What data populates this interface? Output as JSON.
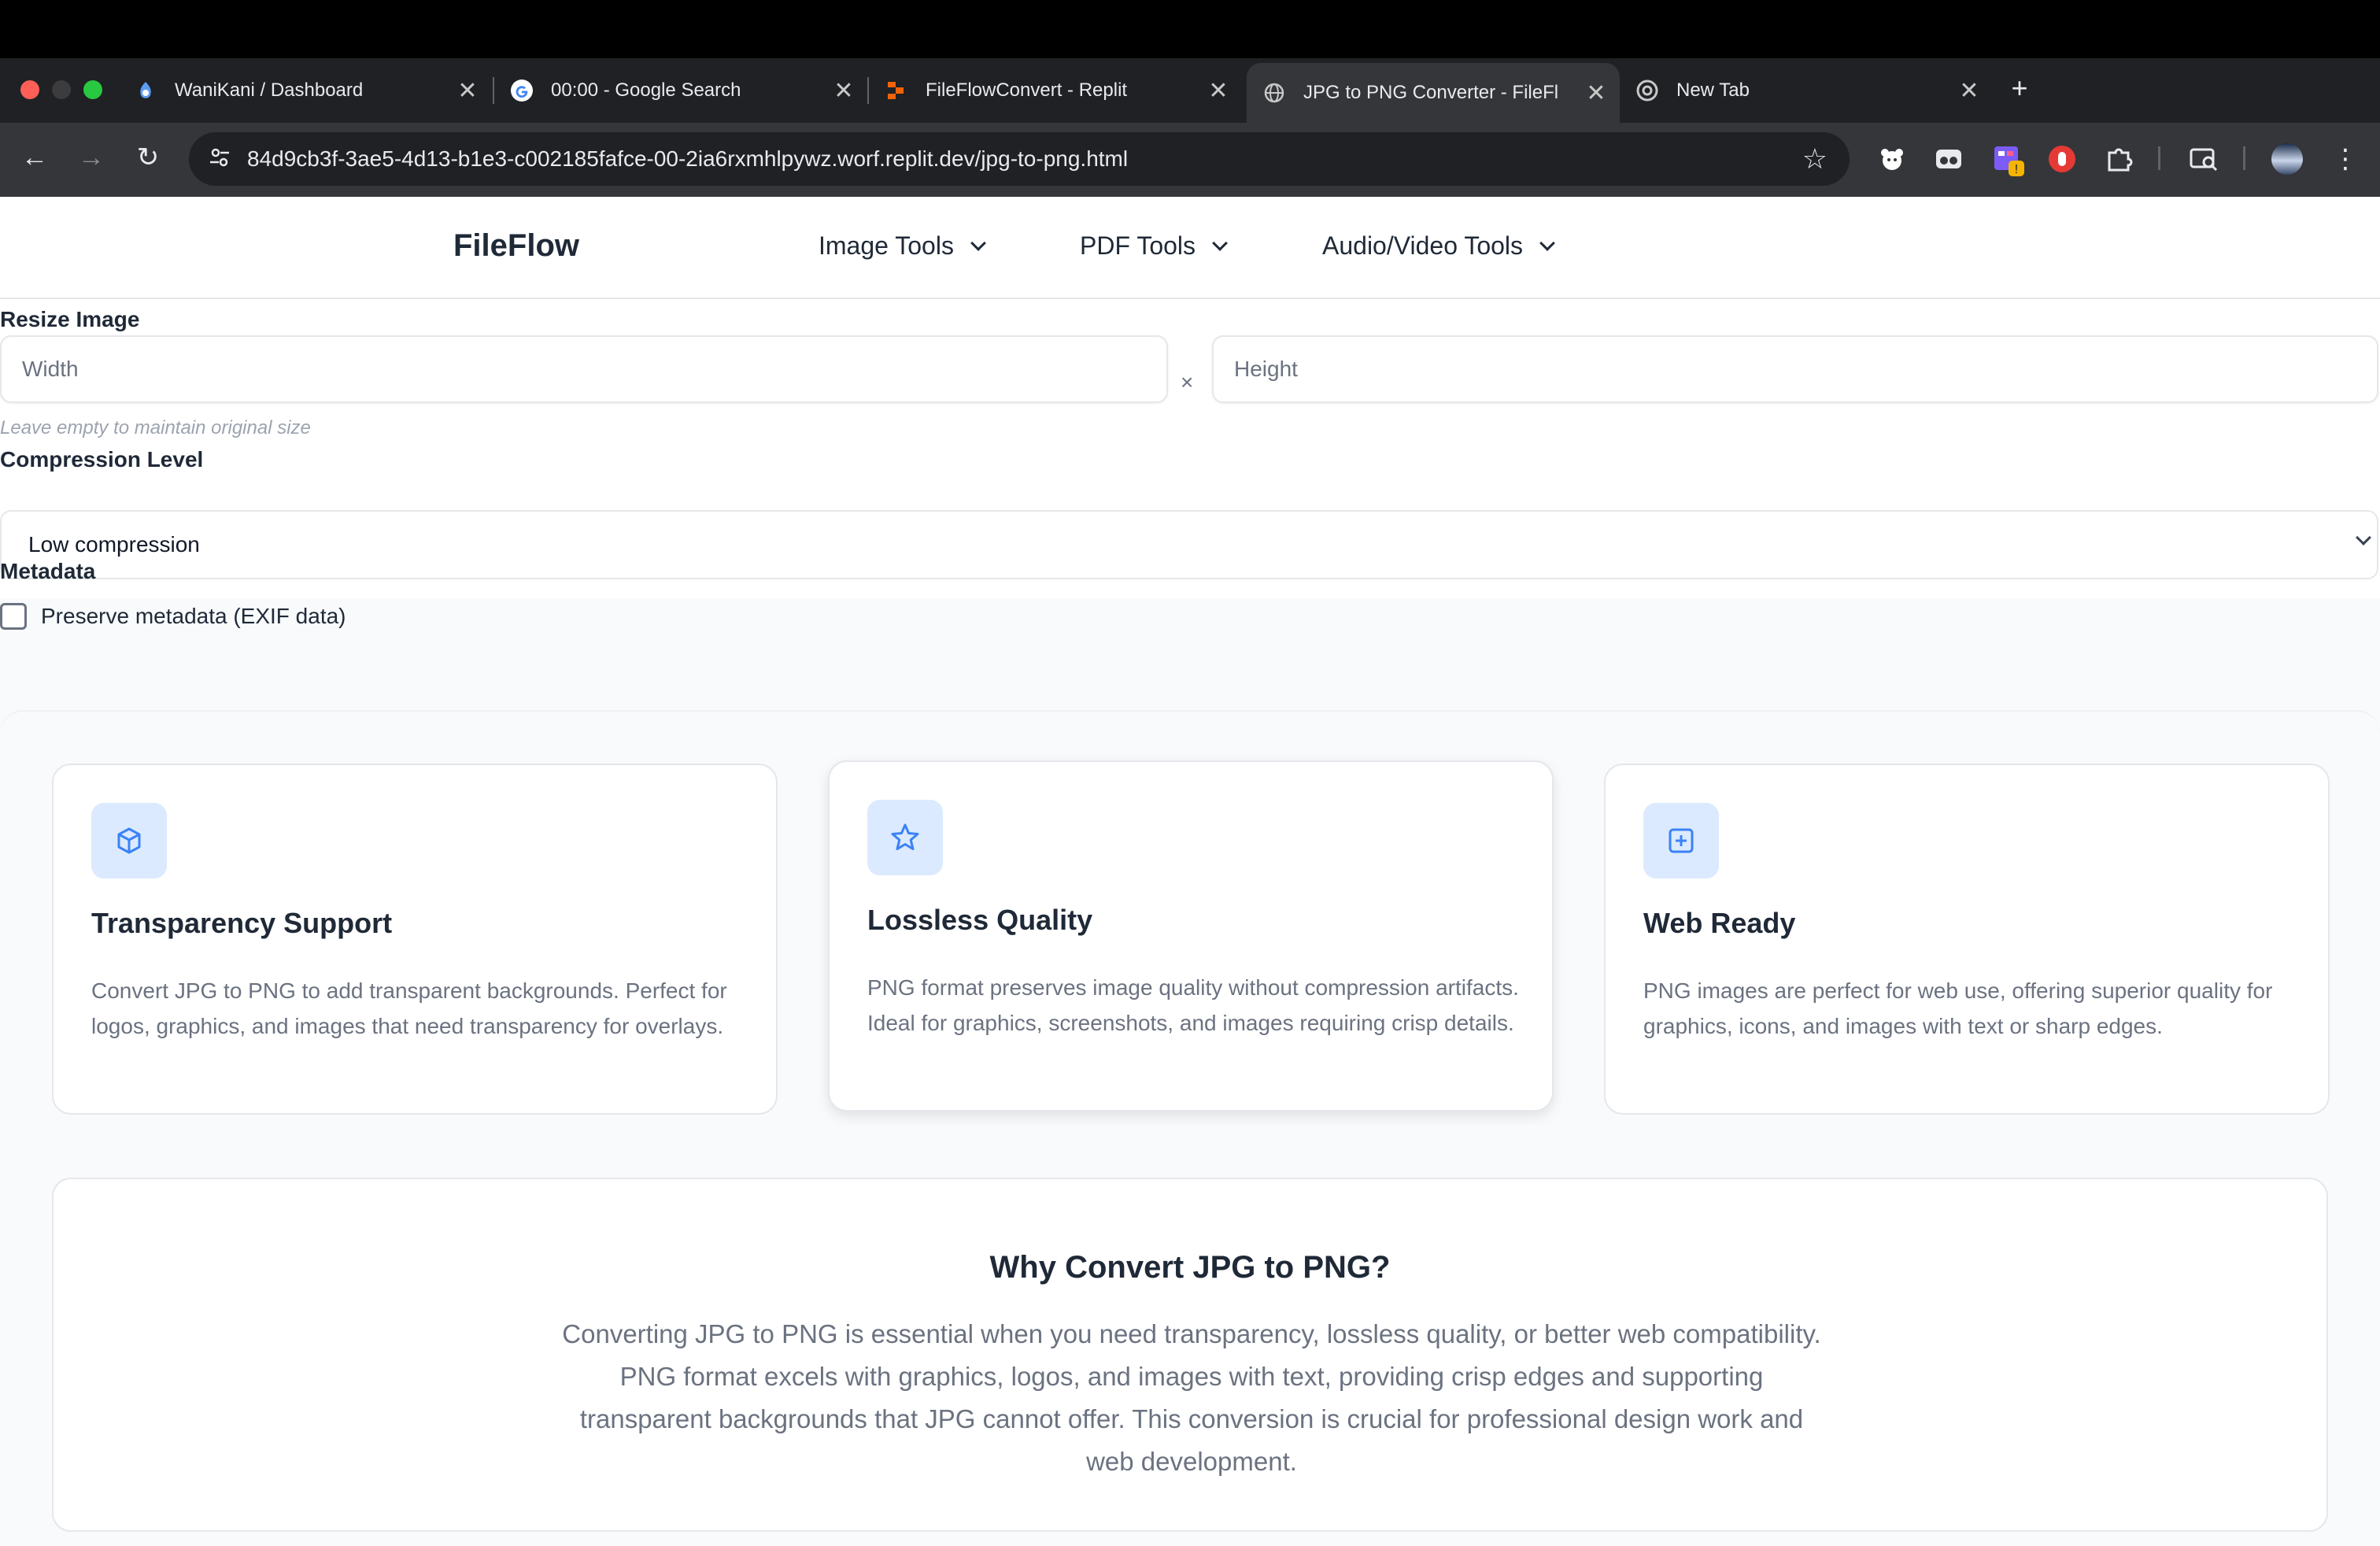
{
  "browser": {
    "tabs": [
      {
        "title": "WaniKani / Dashboard",
        "icon": "wanikani-icon",
        "active": false
      },
      {
        "title": "00:00 - Google Search",
        "icon": "google-icon",
        "active": false
      },
      {
        "title": "FileFlowConvert - Replit",
        "icon": "replit-icon",
        "active": false
      },
      {
        "title": "JPG to PNG Converter - FileFl",
        "icon": "globe-icon",
        "active": true
      },
      {
        "title": "New Tab",
        "icon": "chrome-icon",
        "active": false
      }
    ],
    "url": "84d9cb3f-3ae5-4d13-b1e3-c002185fafce-00-2ia6rxmhlpywz.worf.replit.dev/jpg-to-png.html",
    "close_glyph": "✕",
    "new_tab_glyph": "+"
  },
  "site": {
    "brand": "FileFlow",
    "nav": [
      {
        "label": "Image Tools"
      },
      {
        "label": "PDF Tools"
      },
      {
        "label": "Audio/Video Tools"
      }
    ]
  },
  "options": {
    "resize": {
      "label": "Resize Image",
      "width_placeholder": "Width",
      "height_placeholder": "Height",
      "separator": "×",
      "hint": "Leave empty to maintain original size"
    },
    "compression": {
      "label": "Compression Level",
      "selected": "Low compression"
    },
    "metadata": {
      "label": "Metadata",
      "checkbox_label": "Preserve metadata (EXIF data)",
      "checked": false
    }
  },
  "features": [
    {
      "title": "Transparency Support",
      "description": "Convert JPG to PNG to add transparent backgrounds. Perfect for logos, graphics, and images that need transparency for overlays.",
      "icon": "cube-icon"
    },
    {
      "title": "Lossless Quality",
      "description": "PNG format preserves image quality without compression artifacts. Ideal for graphics, screenshots, and images requiring crisp details.",
      "icon": "star-icon"
    },
    {
      "title": "Web Ready",
      "description": "PNG images are perfect for web use, offering superior quality for graphics, icons, and images with text or sharp edges.",
      "icon": "plus-square-icon"
    }
  ],
  "why": {
    "heading": "Why Convert JPG to PNG?",
    "body": "Converting JPG to PNG is essential when you need transparency, lossless quality, or better web compatibility. PNG format excels with graphics, logos, and images with text, providing crisp edges and supporting transparent backgrounds that JPG cannot offer. This conversion is crucial for professional design work and web development."
  },
  "colors": {
    "accent": "#3b82f6",
    "icon_bg": "#dbeafe",
    "heading": "#1f2937",
    "muted": "#6b7280"
  }
}
